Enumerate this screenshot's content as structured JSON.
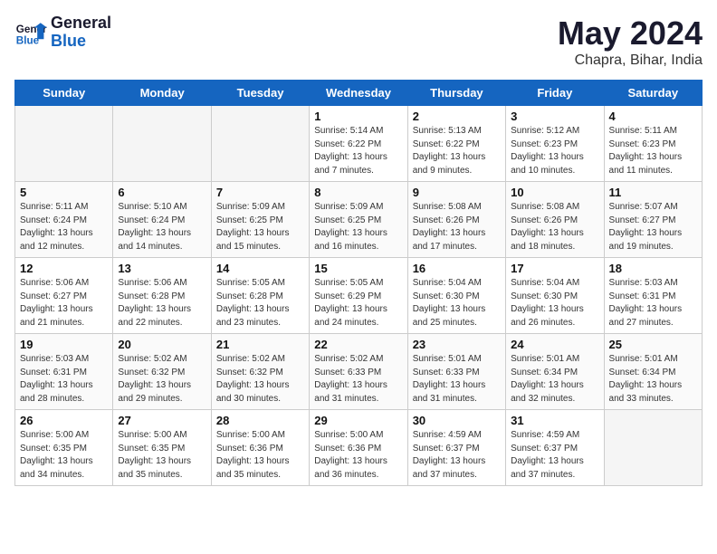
{
  "header": {
    "logo_line1": "General",
    "logo_line2": "Blue",
    "month": "May 2024",
    "location": "Chapra, Bihar, India"
  },
  "days_of_week": [
    "Sunday",
    "Monday",
    "Tuesday",
    "Wednesday",
    "Thursday",
    "Friday",
    "Saturday"
  ],
  "weeks": [
    [
      {
        "day": null
      },
      {
        "day": null
      },
      {
        "day": null
      },
      {
        "day": "1",
        "sunrise": "5:14 AM",
        "sunset": "6:22 PM",
        "daylight": "13 hours and 7 minutes."
      },
      {
        "day": "2",
        "sunrise": "5:13 AM",
        "sunset": "6:22 PM",
        "daylight": "13 hours and 9 minutes."
      },
      {
        "day": "3",
        "sunrise": "5:12 AM",
        "sunset": "6:23 PM",
        "daylight": "13 hours and 10 minutes."
      },
      {
        "day": "4",
        "sunrise": "5:11 AM",
        "sunset": "6:23 PM",
        "daylight": "13 hours and 11 minutes."
      }
    ],
    [
      {
        "day": "5",
        "sunrise": "5:11 AM",
        "sunset": "6:24 PM",
        "daylight": "13 hours and 12 minutes."
      },
      {
        "day": "6",
        "sunrise": "5:10 AM",
        "sunset": "6:24 PM",
        "daylight": "13 hours and 14 minutes."
      },
      {
        "day": "7",
        "sunrise": "5:09 AM",
        "sunset": "6:25 PM",
        "daylight": "13 hours and 15 minutes."
      },
      {
        "day": "8",
        "sunrise": "5:09 AM",
        "sunset": "6:25 PM",
        "daylight": "13 hours and 16 minutes."
      },
      {
        "day": "9",
        "sunrise": "5:08 AM",
        "sunset": "6:26 PM",
        "daylight": "13 hours and 17 minutes."
      },
      {
        "day": "10",
        "sunrise": "5:08 AM",
        "sunset": "6:26 PM",
        "daylight": "13 hours and 18 minutes."
      },
      {
        "day": "11",
        "sunrise": "5:07 AM",
        "sunset": "6:27 PM",
        "daylight": "13 hours and 19 minutes."
      }
    ],
    [
      {
        "day": "12",
        "sunrise": "5:06 AM",
        "sunset": "6:27 PM",
        "daylight": "13 hours and 21 minutes."
      },
      {
        "day": "13",
        "sunrise": "5:06 AM",
        "sunset": "6:28 PM",
        "daylight": "13 hours and 22 minutes."
      },
      {
        "day": "14",
        "sunrise": "5:05 AM",
        "sunset": "6:28 PM",
        "daylight": "13 hours and 23 minutes."
      },
      {
        "day": "15",
        "sunrise": "5:05 AM",
        "sunset": "6:29 PM",
        "daylight": "13 hours and 24 minutes."
      },
      {
        "day": "16",
        "sunrise": "5:04 AM",
        "sunset": "6:30 PM",
        "daylight": "13 hours and 25 minutes."
      },
      {
        "day": "17",
        "sunrise": "5:04 AM",
        "sunset": "6:30 PM",
        "daylight": "13 hours and 26 minutes."
      },
      {
        "day": "18",
        "sunrise": "5:03 AM",
        "sunset": "6:31 PM",
        "daylight": "13 hours and 27 minutes."
      }
    ],
    [
      {
        "day": "19",
        "sunrise": "5:03 AM",
        "sunset": "6:31 PM",
        "daylight": "13 hours and 28 minutes."
      },
      {
        "day": "20",
        "sunrise": "5:02 AM",
        "sunset": "6:32 PM",
        "daylight": "13 hours and 29 minutes."
      },
      {
        "day": "21",
        "sunrise": "5:02 AM",
        "sunset": "6:32 PM",
        "daylight": "13 hours and 30 minutes."
      },
      {
        "day": "22",
        "sunrise": "5:02 AM",
        "sunset": "6:33 PM",
        "daylight": "13 hours and 31 minutes."
      },
      {
        "day": "23",
        "sunrise": "5:01 AM",
        "sunset": "6:33 PM",
        "daylight": "13 hours and 31 minutes."
      },
      {
        "day": "24",
        "sunrise": "5:01 AM",
        "sunset": "6:34 PM",
        "daylight": "13 hours and 32 minutes."
      },
      {
        "day": "25",
        "sunrise": "5:01 AM",
        "sunset": "6:34 PM",
        "daylight": "13 hours and 33 minutes."
      }
    ],
    [
      {
        "day": "26",
        "sunrise": "5:00 AM",
        "sunset": "6:35 PM",
        "daylight": "13 hours and 34 minutes."
      },
      {
        "day": "27",
        "sunrise": "5:00 AM",
        "sunset": "6:35 PM",
        "daylight": "13 hours and 35 minutes."
      },
      {
        "day": "28",
        "sunrise": "5:00 AM",
        "sunset": "6:36 PM",
        "daylight": "13 hours and 35 minutes."
      },
      {
        "day": "29",
        "sunrise": "5:00 AM",
        "sunset": "6:36 PM",
        "daylight": "13 hours and 36 minutes."
      },
      {
        "day": "30",
        "sunrise": "4:59 AM",
        "sunset": "6:37 PM",
        "daylight": "13 hours and 37 minutes."
      },
      {
        "day": "31",
        "sunrise": "4:59 AM",
        "sunset": "6:37 PM",
        "daylight": "13 hours and 37 minutes."
      },
      {
        "day": null
      }
    ]
  ]
}
